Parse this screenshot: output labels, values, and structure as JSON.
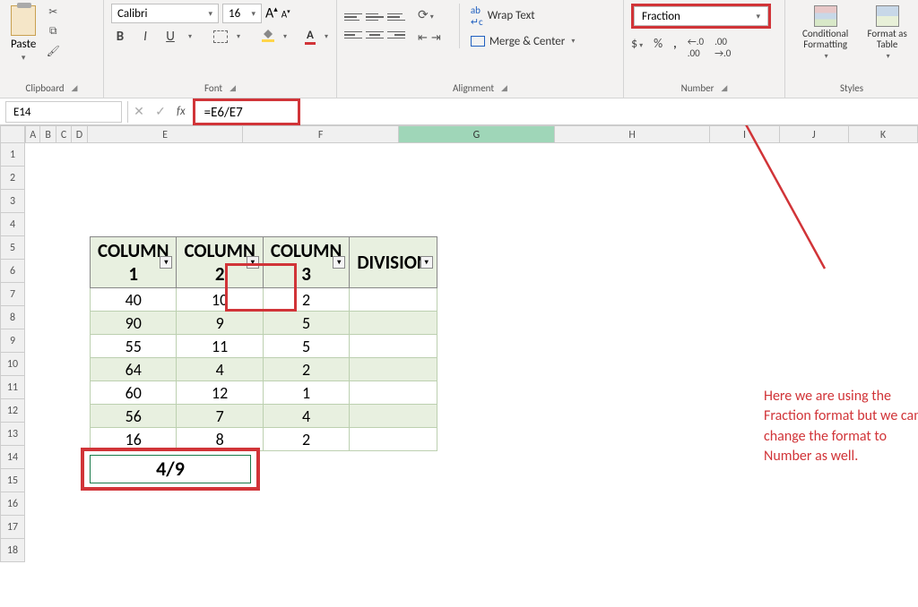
{
  "ribbon": {
    "clipboard": {
      "label": "Clipboard",
      "paste": "Paste"
    },
    "font": {
      "label": "Font",
      "name": "Calibri",
      "size": "16",
      "bold": "B",
      "italic": "I",
      "underline": "U",
      "font_color_letter": "A"
    },
    "alignment": {
      "label": "Alignment",
      "wrap": "Wrap Text",
      "merge": "Merge & Center"
    },
    "number": {
      "label": "Number",
      "format": "Fraction",
      "decimal_inc": ".0",
      "decimal_dec": ".00"
    },
    "styles": {
      "label": "Styles",
      "conditional": "Conditional Formatting",
      "format_table": "Format as Table"
    }
  },
  "formula_bar": {
    "name_box": "E14",
    "fx": "fx",
    "formula": "=E6/E7"
  },
  "columns": [
    "A",
    "B",
    "C",
    "D",
    "E",
    "F",
    "G",
    "H",
    "I",
    "J",
    "K"
  ],
  "rows": [
    "1",
    "2",
    "3",
    "4",
    "5",
    "6",
    "7",
    "8",
    "9",
    "10",
    "11",
    "12",
    "13",
    "14",
    "15",
    "16",
    "17",
    "18"
  ],
  "table": {
    "headers": [
      "COLUMN 1",
      "COLUMN 2",
      "COLUMN 3",
      "DIVISION"
    ],
    "rows": [
      [
        "40",
        "10",
        "2",
        ""
      ],
      [
        "90",
        "9",
        "5",
        ""
      ],
      [
        "55",
        "11",
        "5",
        ""
      ],
      [
        "64",
        "4",
        "2",
        ""
      ],
      [
        "60",
        "12",
        "1",
        ""
      ],
      [
        "56",
        "7",
        "4",
        ""
      ],
      [
        "16",
        "8",
        "2",
        ""
      ]
    ]
  },
  "result": "4/9",
  "annotation": "Here we are using the Fraction format but we can change the format to Number as well."
}
